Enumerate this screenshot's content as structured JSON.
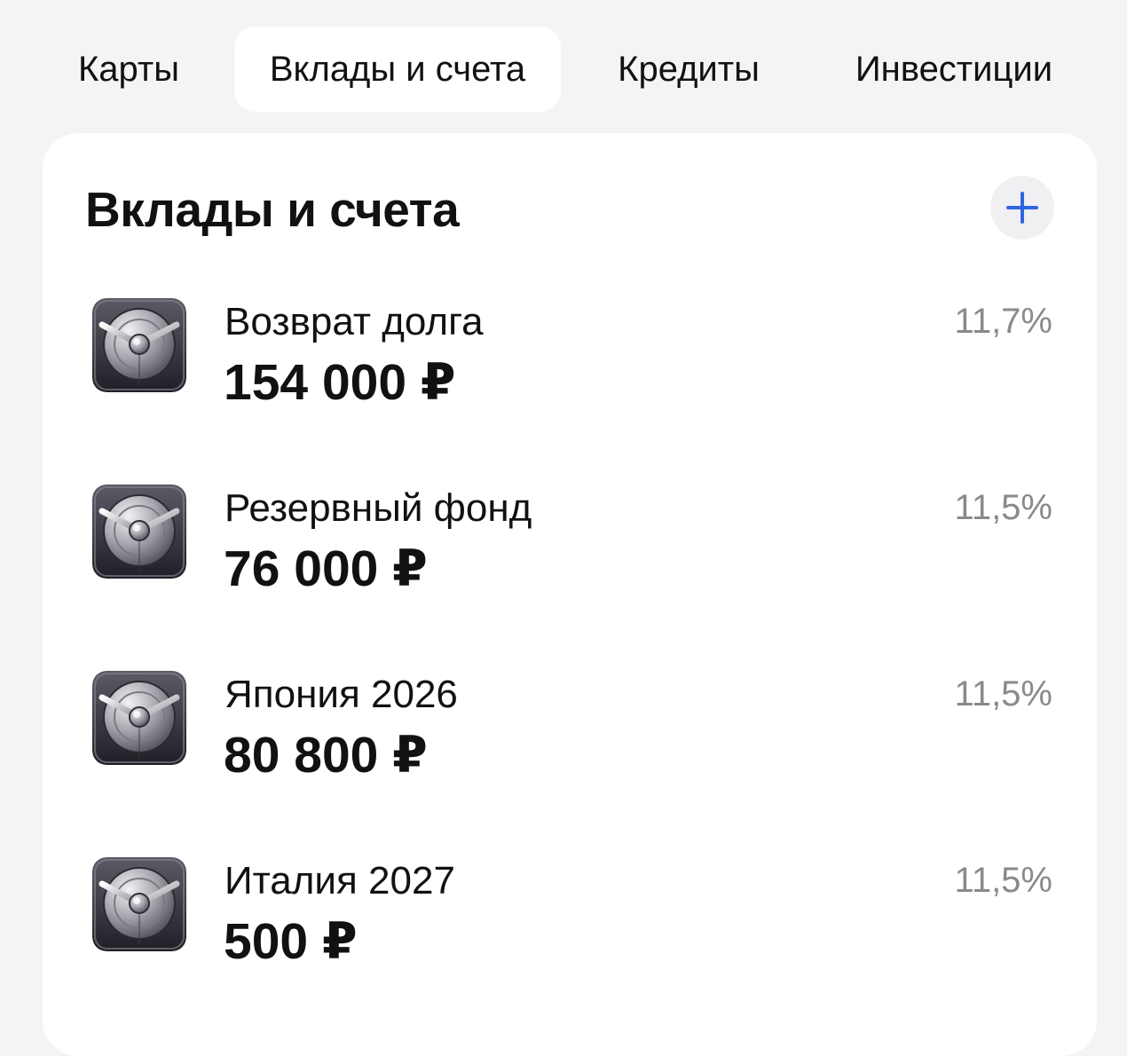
{
  "tabs": [
    {
      "label": "Карты",
      "active": false
    },
    {
      "label": "Вклады и счета",
      "active": true
    },
    {
      "label": "Кредиты",
      "active": false
    },
    {
      "label": "Инвестиции",
      "active": false
    }
  ],
  "section": {
    "title": "Вклады и счета",
    "add_icon": "plus-icon",
    "accent_color": "#2f66e0"
  },
  "accounts": [
    {
      "name": "Возврат долга",
      "amount": "154 000 ₽",
      "rate": "11,7%",
      "icon": "safe-vault-icon"
    },
    {
      "name": "Резервный фонд",
      "amount": "76 000 ₽",
      "rate": "11,5%",
      "icon": "safe-vault-icon"
    },
    {
      "name": "Япония 2026",
      "amount": "80 800 ₽",
      "rate": "11,5%",
      "icon": "safe-vault-icon"
    },
    {
      "name": "Италия 2027",
      "amount": "500 ₽",
      "rate": "11,5%",
      "icon": "safe-vault-icon"
    }
  ]
}
